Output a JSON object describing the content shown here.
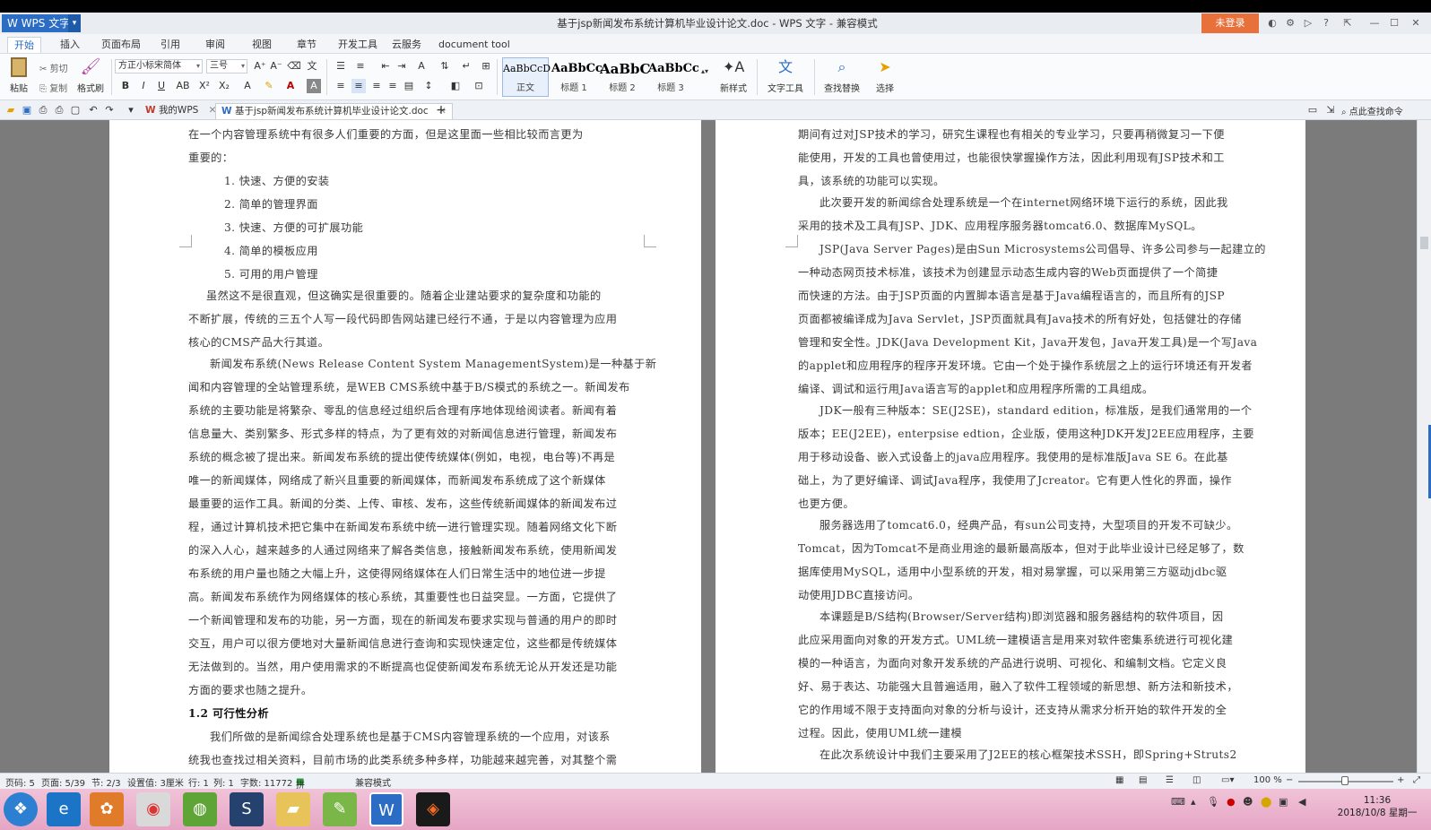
{
  "app": {
    "logo": "W WPS 文字",
    "title": "基于jsp新闻发布系统计算机毕业设计论文.doc - WPS 文字 - 兼容模式",
    "login": "未登录"
  },
  "menu_tabs": [
    "开始",
    "插入",
    "页面布局",
    "引用",
    "审阅",
    "视图",
    "章节",
    "开发工具",
    "云服务",
    "document tool"
  ],
  "ribbon": {
    "paste": "粘贴",
    "cut": "剪切",
    "copy": "复制",
    "format_painter": "格式刷",
    "font_name": "方正小标宋简体",
    "font_size": "三号",
    "styles": [
      {
        "sample": "AaBbCcD",
        "name": "正文"
      },
      {
        "sample": "AaBbCc",
        "name": "标题 1"
      },
      {
        "sample": "AaBbC",
        "name": "标题 2"
      },
      {
        "sample": "AaBbCc",
        "name": "标题 3"
      }
    ],
    "new_style": "新样式",
    "text_tools": "文字工具",
    "find_replace": "查找替换",
    "select": "选择"
  },
  "doc_tabs": {
    "home": "我的WPS",
    "active": "基于jsp新闻发布系统计算机毕业设计论文.doc",
    "search": "点此查找命令"
  },
  "page_left": [
    "在一个内容管理系统中有很多人们重要的方面，但是这里面一些相比较而言更为",
    "重要的：",
    "1. 快速、方便的安装",
    "2. 简单的管理界面",
    "3. 快速、方便的可扩展功能",
    "4. 简单的模板应用",
    "5. 可用的用户管理",
    "虽然这不是很直观，但这确实是很重要的。随着企业建站要求的复杂度和功能的",
    "不断扩展，传统的三五个人写一段代码即告网站建已经行不通，于是以内容管理为应用",
    "核心的CMS产品大行其道。",
    "新闻发布系统(News Release Content System ManagementSystem)是一种基于新",
    "闻和内容管理的全站管理系统，是WEB CMS系统中基于B/S模式的系统之一。新闻发布",
    "系统的主要功能是将繁杂、零乱的信息经过组织后合理有序地体现给阅读者。新闻有着",
    "信息量大、类别繁多、形式多样的特点，为了更有效的对新闻信息进行管理，新闻发布",
    "系统的概念被了提出来。新闻发布系统的提出使传统媒体(例如，电视，电台等)不再是",
    "唯一的新闻媒体，网络成了新兴且重要的新闻媒体，而新闻发布系统成了这个新媒体",
    "最重要的运作工具。新闻的分类、上传、审核、发布，这些传统新闻媒体的新闻发布过",
    "程，通过计算机技术把它集中在新闻发布系统中统一进行管理实现。随着网络文化下断",
    "的深入人心，越来越多的人通过网络来了解各类信息，接触新闻发布系统，使用新闻发",
    "布系统的用户量也随之大幅上升，这使得网络媒体在人们日常生活中的地位进一步提",
    "高。新闻发布系统作为网络媒体的核心系统，其重要性也日益突显。一方面，它提供了",
    "一个新闻管理和发布的功能，另一方面，现在的新闻发布要求实现与普通的用户的即时",
    "交互，用户可以很方便地对大量新闻信息进行查询和实现快速定位，这些都是传统媒体",
    "无法做到的。当然，用户使用需求的不断提高也促使新闻发布系统无论从开发还是功能",
    "方面的要求也随之提升。",
    "1.2 可行性分析",
    "我们所做的是新闻综合处理系统也是基于CMS内容管理系统的一个应用，对该系",
    "统我也查找过相关资料，目前市场的此类系统多种多样，功能越来越完善，对其整个需"
  ],
  "page_right": [
    "期间有过对JSP技术的学习，研究生课程也有相关的专业学习，只要再稍微复习一下便",
    "能使用，开发的工具也曾使用过，也能很快掌握操作方法，因此利用现有JSP技术和工",
    "具，该系统的功能可以实现。",
    "此次要开发的新闻综合处理系统是一个在internet网络环境下运行的系统，因此我",
    "采用的技术及工具有JSP、JDK、应用程序服务器tomcat6.0、数据库MySQL。",
    "JSP(Java Server Pages)是由Sun Microsystems公司倡导、许多公司参与一起建立的",
    "一种动态网页技术标准，该技术为创建显示动态生成内容的Web页面提供了一个简捷",
    "而快速的方法。由于JSP页面的内置脚本语言是基于Java编程语言的，而且所有的JSP",
    "页面都被编译成为Java Servlet，JSP页面就具有Java技术的所有好处，包括健壮的存储",
    "管理和安全性。JDK(Java Development Kit，Java开发包，Java开发工具)是一个写Java",
    "的applet和应用程序的程序开发环境。它由一个处于操作系统层之上的运行环境还有开发者",
    "编译、调试和运行用Java语言写的applet和应用程序所需的工具组成。",
    "JDK一般有三种版本：SE(J2SE)，standard edition，标准版，是我们通常用的一个",
    "版本；EE(J2EE)，enterpsise edtion，企业版，使用这种JDK开发J2EE应用程序，主要",
    "用于移动设备、嵌入式设备上的java应用程序。我使用的是标准版Java SE 6。在此基",
    "础上，为了更好编译、调试Java程序，我使用了Jcreator。它有更人性化的界面，操作",
    "也更方便。",
    "服务器选用了tomcat6.0，经典产品，有sun公司支持，大型项目的开发不可缺少。",
    "Tomcat，因为Tomcat不是商业用途的最新最高版本，但对于此毕业设计已经足够了，数",
    "据库使用MySQL，适用中小型系统的开发，相对易掌握，可以采用第三方驱动jdbc驱",
    "动使用JDBC直接访问。",
    "本课题是B/S结构(Browser/Server结构)即浏览器和服务器结构的软件项目，因",
    "此应采用面向对象的开发方式。UML统一建模语言是用来对软件密集系统进行可视化建",
    "模的一种语言，为面向对象开发系统的产品进行说明、可视化、和编制文档。它定义良",
    "好、易于表达、功能强大且普遍适用，融入了软件工程领域的新思想、新方法和新技术，",
    "它的作用域不限于支持面向对象的分析与设计，还支持从需求分析开始的软件开发的全",
    "过程。因此，使用UML统一建模",
    "在此次系统设计中我们主要采用了J2EE的核心框架技术SSH，即Spring+Struts2"
  ],
  "status": {
    "page": "页码: 5",
    "pages": "页面: 5/39",
    "section": "节: 2/3",
    "setting": "设置值: 3厘米",
    "row": "行: 1",
    "col": "列: 1",
    "words": "字数: 11772",
    "spell": "拼写检查",
    "compat": "兼容模式",
    "zoom": "100 %"
  },
  "clock": {
    "time": "11:36",
    "date": "2018/10/8 星期一"
  }
}
